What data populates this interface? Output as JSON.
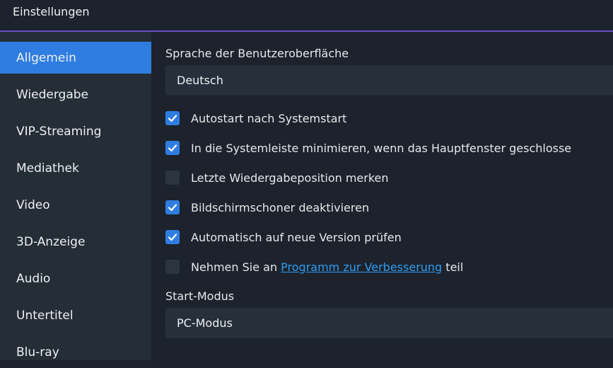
{
  "window": {
    "title": "Einstellungen"
  },
  "sidebar": {
    "items": [
      {
        "label": "Allgemein",
        "active": true
      },
      {
        "label": "Wiedergabe"
      },
      {
        "label": "VIP-Streaming"
      },
      {
        "label": "Mediathek"
      },
      {
        "label": "Video"
      },
      {
        "label": "3D-Anzeige"
      },
      {
        "label": "Audio"
      },
      {
        "label": "Untertitel"
      },
      {
        "label": "Blu-ray"
      }
    ]
  },
  "main": {
    "language_label": "Sprache der Benutzeroberfläche",
    "language_value": "Deutsch",
    "options": [
      {
        "label": "Autostart nach Systemstart",
        "checked": true
      },
      {
        "label": "In die Systemleiste minimieren, wenn das Hauptfenster geschlosse",
        "checked": true
      },
      {
        "label": "Letzte Wiedergabeposition merken",
        "checked": false
      },
      {
        "label": "Bildschirmschoner deaktivieren",
        "checked": true
      },
      {
        "label": "Automatisch auf neue Version prüfen",
        "checked": true
      }
    ],
    "program_option": {
      "checked": false,
      "prefix": "Nehmen Sie an ",
      "link": "Programm zur Verbesserung",
      "suffix": " teil"
    },
    "start_mode_label": "Start-Modus",
    "start_mode_value": "PC-Modus"
  },
  "colors": {
    "accent": "#2f7de0",
    "link": "#2f9bf0",
    "title_border": "#6a4fc7"
  }
}
